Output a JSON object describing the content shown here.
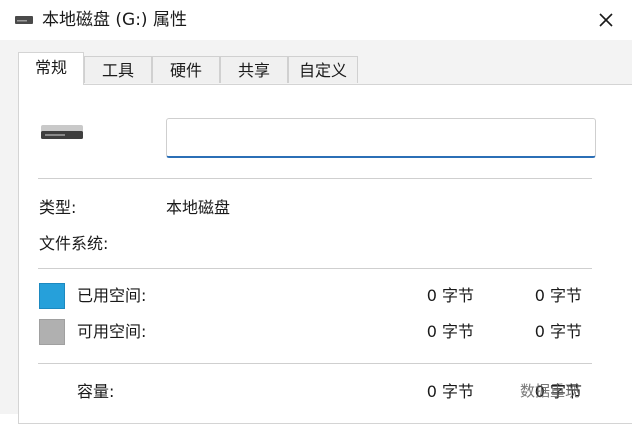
{
  "window": {
    "title": "本地磁盘 (G:) 属性",
    "close_label": "✕"
  },
  "tabs": [
    {
      "label": "常规",
      "active": true
    },
    {
      "label": "工具",
      "active": false
    },
    {
      "label": "硬件",
      "active": false
    },
    {
      "label": "共享",
      "active": false
    },
    {
      "label": "自定义",
      "active": false
    }
  ],
  "general": {
    "name_value": "",
    "type_label": "类型:",
    "type_value": "本地磁盘",
    "filesystem_label": "文件系统:",
    "filesystem_value": "",
    "used_label": "已用空间:",
    "used_bytes": "0 字节",
    "used_size": "0 字节",
    "free_label": "可用空间:",
    "free_bytes": "0 字节",
    "free_size": "0 字节",
    "capacity_label": "容量:",
    "capacity_bytes": "0 字节",
    "capacity_size": "0 字节"
  },
  "colors": {
    "used": "#26a0da",
    "free": "#b0b0b0",
    "input_accent": "#2b6fb6"
  },
  "icons": {
    "title": "drive-icon",
    "drive": "drive-icon",
    "close": "close-icon"
  },
  "watermark": "数据重现"
}
